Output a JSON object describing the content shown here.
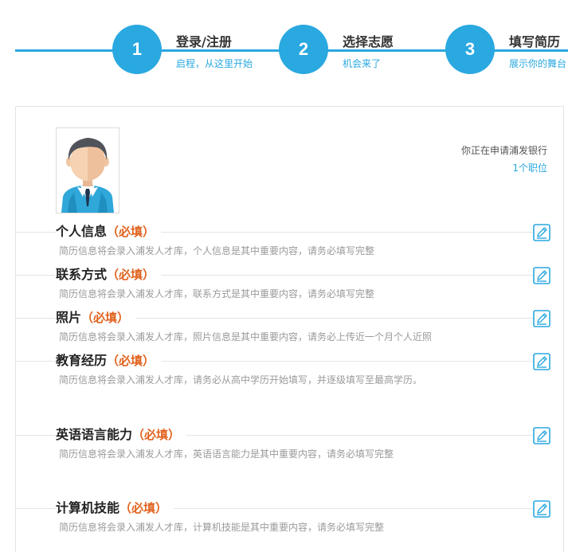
{
  "steps": [
    {
      "number": "1",
      "title": "登录/注册",
      "subtitle": "启程，从这里开始"
    },
    {
      "number": "2",
      "title": "选择志愿",
      "subtitle": "机会来了"
    },
    {
      "number": "3",
      "title": "填写简历",
      "subtitle": "展示你的舞台"
    }
  ],
  "apply": {
    "bank_text": "你正在申请浦发银行",
    "jobs_text": "1个职位"
  },
  "sections": [
    {
      "name": "个人信息",
      "required": "（必填）",
      "description": "简历信息将会录入浦发人才库，个人信息是其中重要内容，请务必填写完整"
    },
    {
      "name": "联系方式",
      "required": "（必填）",
      "description": "简历信息将会录入浦发人才库，联系方式是其中重要内容，请务必填写完整"
    },
    {
      "name": "照片",
      "required": "（必填）",
      "description": "简历信息将会录入浦发人才库，照片信息是其中重要内容，请务必上传近一个月个人近照"
    },
    {
      "name": "教育经历",
      "required": "（必填）",
      "description": "简历信息将会录入浦发人才库，请务必从高中学历开始填写，并逐级填写至最高学历。"
    },
    {
      "name": "英语语言能力",
      "required": "（必填）",
      "description": "简历信息将会录入浦发人才库，英语语言能力是其中重要内容，请务必填写完整"
    },
    {
      "name": "计算机技能",
      "required": "（必填）",
      "description": "简历信息将会录入浦发人才库，计算机技能是其中重要内容，请务必填写完整"
    }
  ],
  "colors": {
    "accent": "#2aa8e0",
    "required": "#e0621d"
  },
  "icons": {
    "edit": "edit-icon",
    "avatar": "person-avatar"
  }
}
